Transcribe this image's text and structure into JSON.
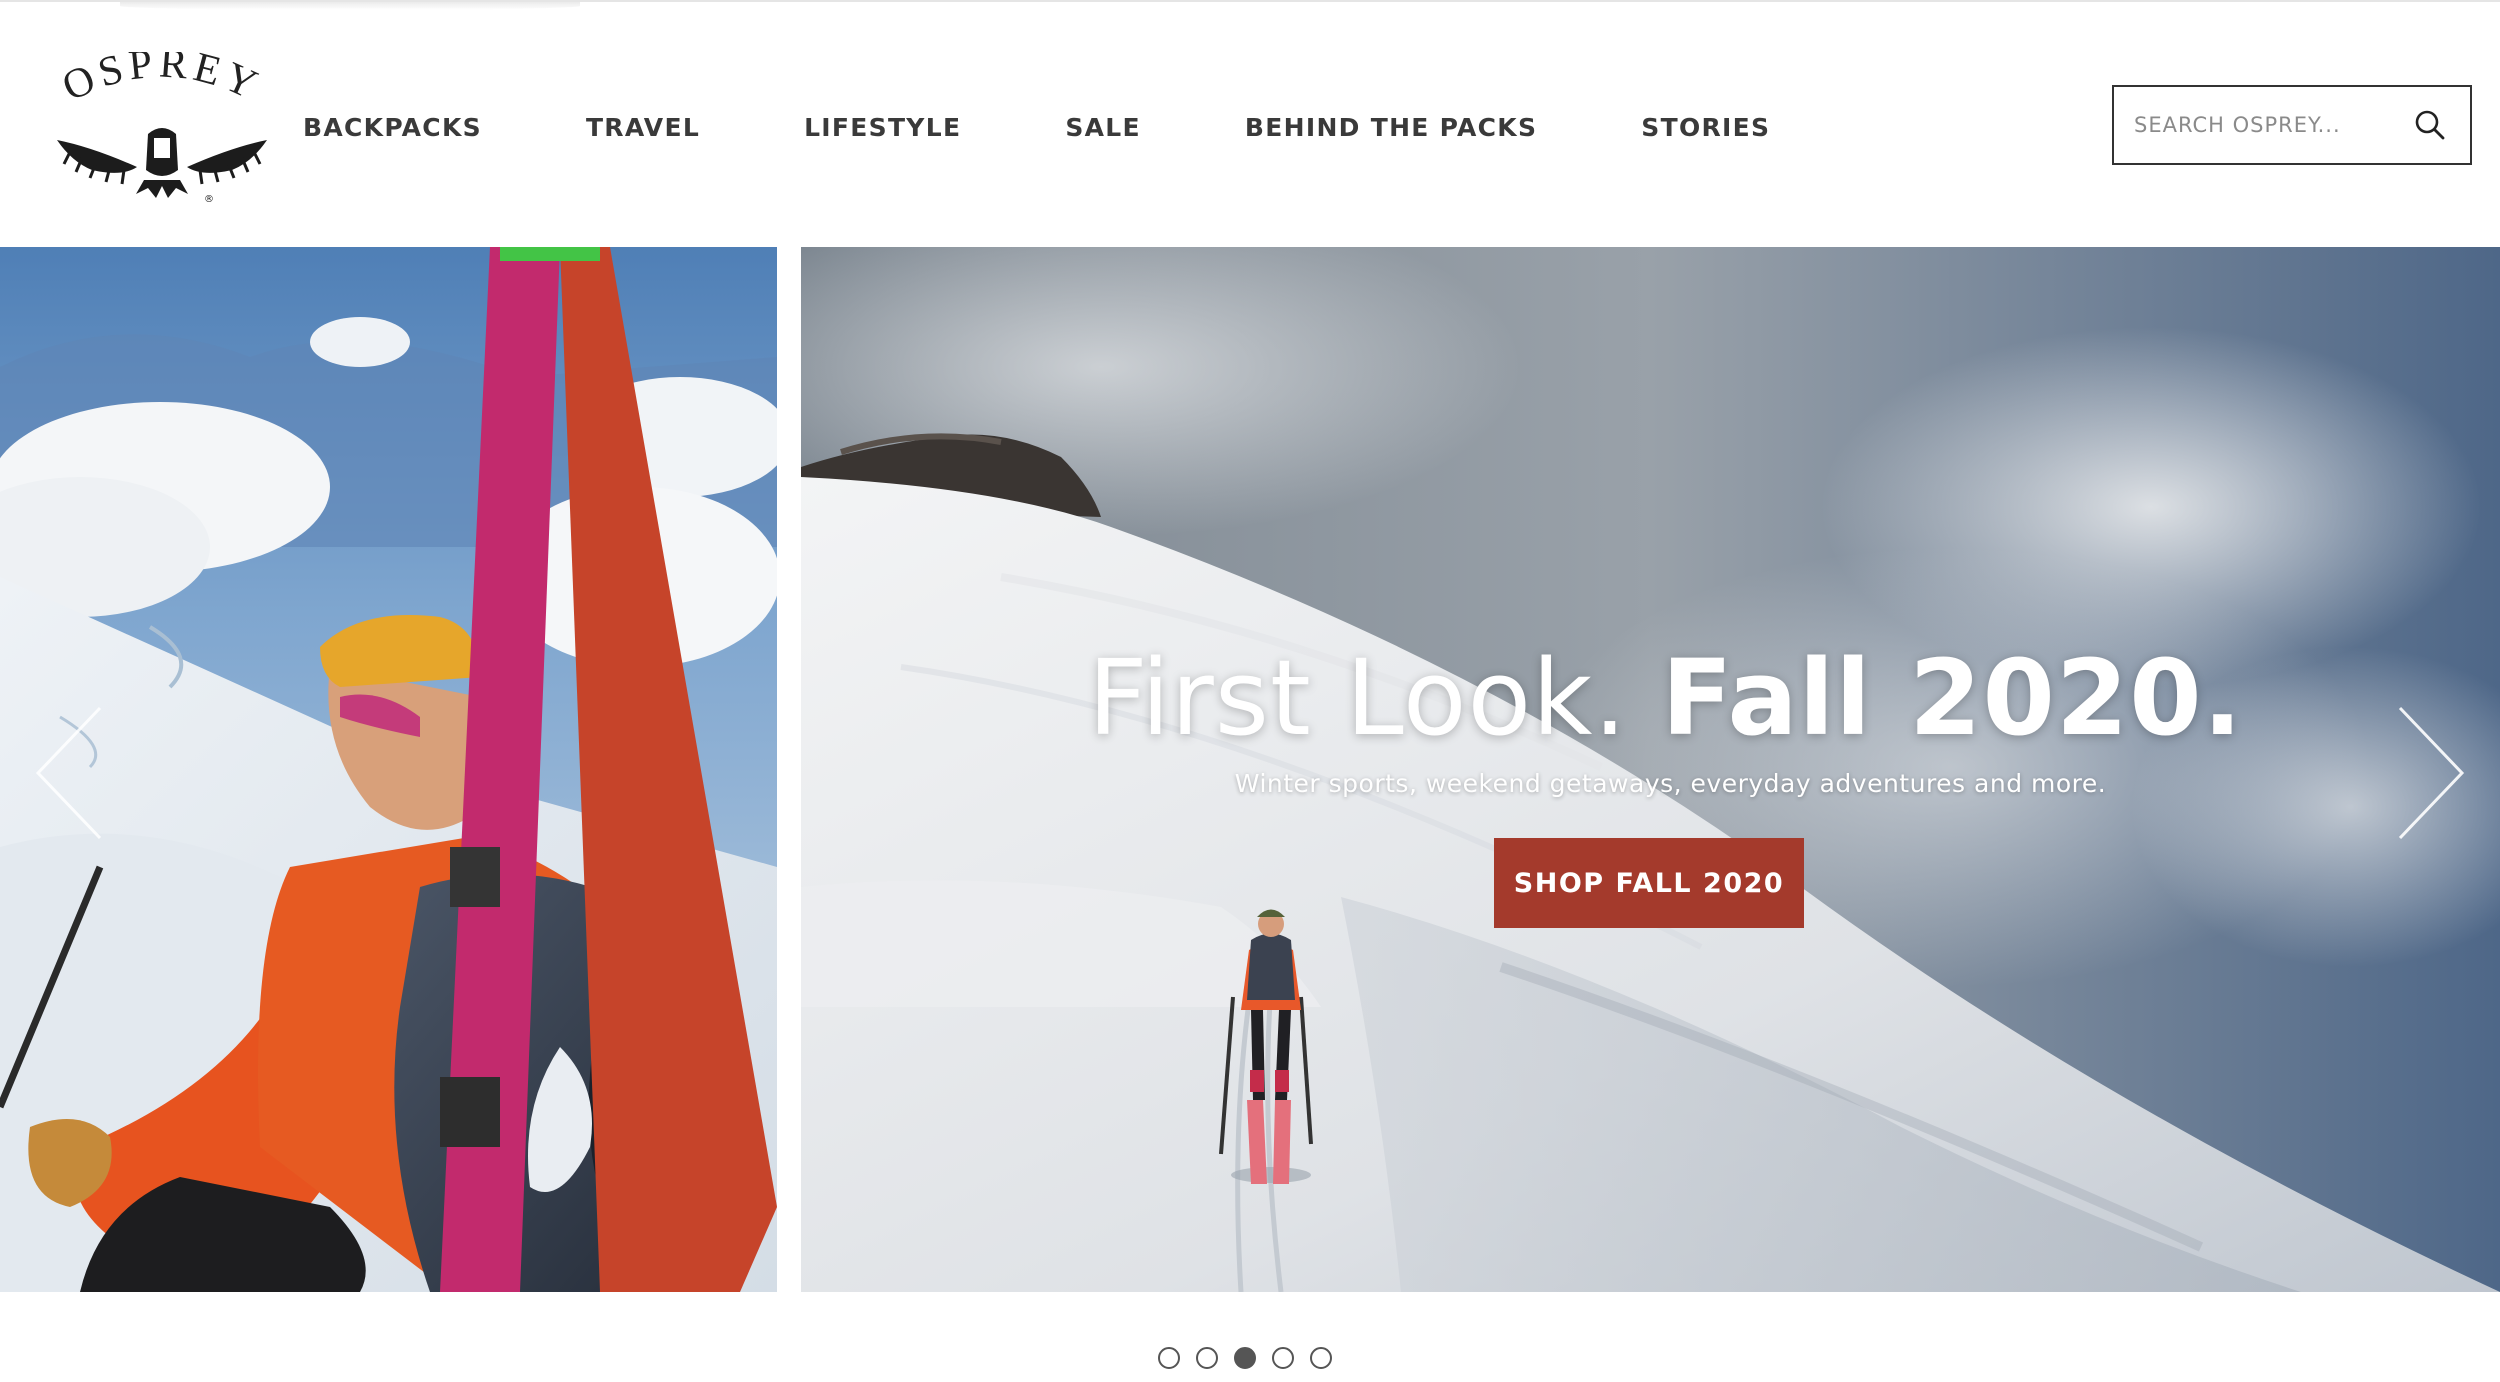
{
  "brand": {
    "name": "OSPREY",
    "registered_mark": "®"
  },
  "nav": {
    "items": [
      {
        "label": "BACKPACKS"
      },
      {
        "label": "TRAVEL"
      },
      {
        "label": "LIFESTYLE"
      },
      {
        "label": "SALE"
      },
      {
        "label": "BEHIND THE PACKS"
      },
      {
        "label": "STORIES"
      }
    ]
  },
  "search": {
    "placeholder": "SEARCH OSPREY...",
    "value": "",
    "icon": "search-icon"
  },
  "hero": {
    "headline_light": "First Look. ",
    "headline_bold": "Fall 2020.",
    "subhead": "Winter sports, weekend getaways, everyday adventures and more.",
    "cta_label": "SHOP FALL 2020"
  },
  "carousel": {
    "slide_count": 5,
    "active_index": 2,
    "prev_icon": "chevron-left-icon",
    "next_icon": "chevron-right-icon"
  },
  "colors": {
    "cta_background": "#a43a2c",
    "nav_text": "#3a3a3a",
    "dot_active": "#555555"
  }
}
